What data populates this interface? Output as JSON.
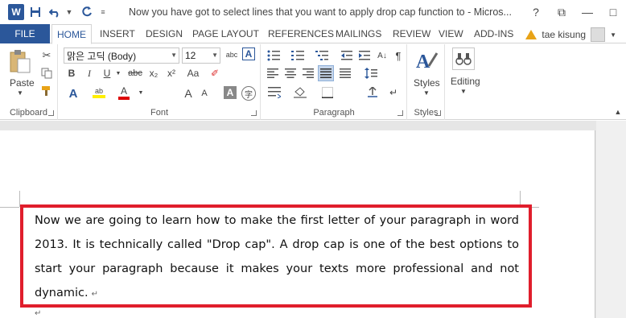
{
  "window": {
    "title": "Now you have got to select lines that you want to apply drop cap function to - Micros...",
    "controls": [
      "?",
      "⧉",
      "—",
      "□"
    ]
  },
  "qat": {
    "app_icon": "W",
    "save_icon": "save-icon",
    "undo_icon": "undo-icon",
    "redo_icon": "redo-icon"
  },
  "tabs": {
    "file": "FILE",
    "items": [
      "HOME",
      "INSERT",
      "DESIGN",
      "PAGE LAYOUT",
      "REFERENCES",
      "MAILINGS",
      "REVIEW",
      "VIEW",
      "ADD-INS"
    ],
    "active": "HOME"
  },
  "user": {
    "name": "tae kisung"
  },
  "ribbon": {
    "clipboard": {
      "label": "Clipboard",
      "paste": "Paste"
    },
    "font": {
      "label": "Font",
      "font_name": "맑은 고딕 (Body)",
      "font_size": "12",
      "bold": "B",
      "italic": "I",
      "underline": "U",
      "strike": "abc",
      "sub": "x₂",
      "sup": "x²",
      "grow": "A",
      "shrink": "A",
      "case": "Aa",
      "abc": "abc",
      "font_color": "A",
      "clear": "A",
      "char_shading": "A",
      "enclose": "字"
    },
    "paragraph": {
      "label": "Paragraph",
      "pilcrow": "¶"
    },
    "styles": {
      "label": "Styles",
      "button": "Styles"
    },
    "editing": {
      "button": "Editing"
    }
  },
  "document": {
    "paragraph": "Now we are going to learn how to make the first letter of your paragraph in word 2013. It is technically called \"Drop cap\". A drop cap is one of the best options to start your paragraph because it makes your texts more professional and not dynamic.",
    "pilcrow": "↵",
    "highlight_color": "#e01e2c"
  },
  "colors": {
    "accent": "#2b579a",
    "highlight": "#e01e2c"
  }
}
